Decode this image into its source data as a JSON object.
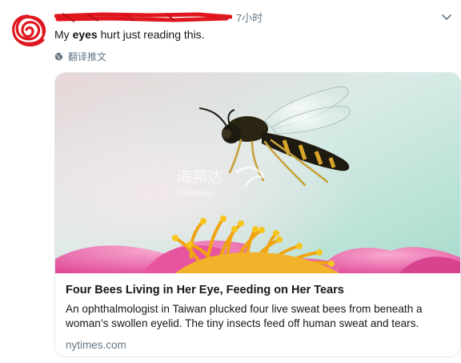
{
  "tweet": {
    "time": "7小时",
    "separator": "·",
    "text_prefix": "My ",
    "text_bold": "eyes",
    "text_suffix": " hurt just reading this.",
    "translate_label": "翻译推文",
    "translate_icon": "globe-icon",
    "more_icon": "chevron-down-icon"
  },
  "card": {
    "image_watermark_cn": "海邦达",
    "image_watermark_en": "Hinabian",
    "title": "Four Bees Living in Her Eye, Feeding on Her Tears",
    "description": "An ophthalmologist in Taiwan plucked four live sweat bees from beneath a woman’s swollen eyelid. The tiny insects feed off human sweat and tears.",
    "domain": "nytimes.com"
  },
  "colors": {
    "redaction": "#e0161e",
    "secondary_text": "#657786",
    "border": "#e1e8ed"
  }
}
